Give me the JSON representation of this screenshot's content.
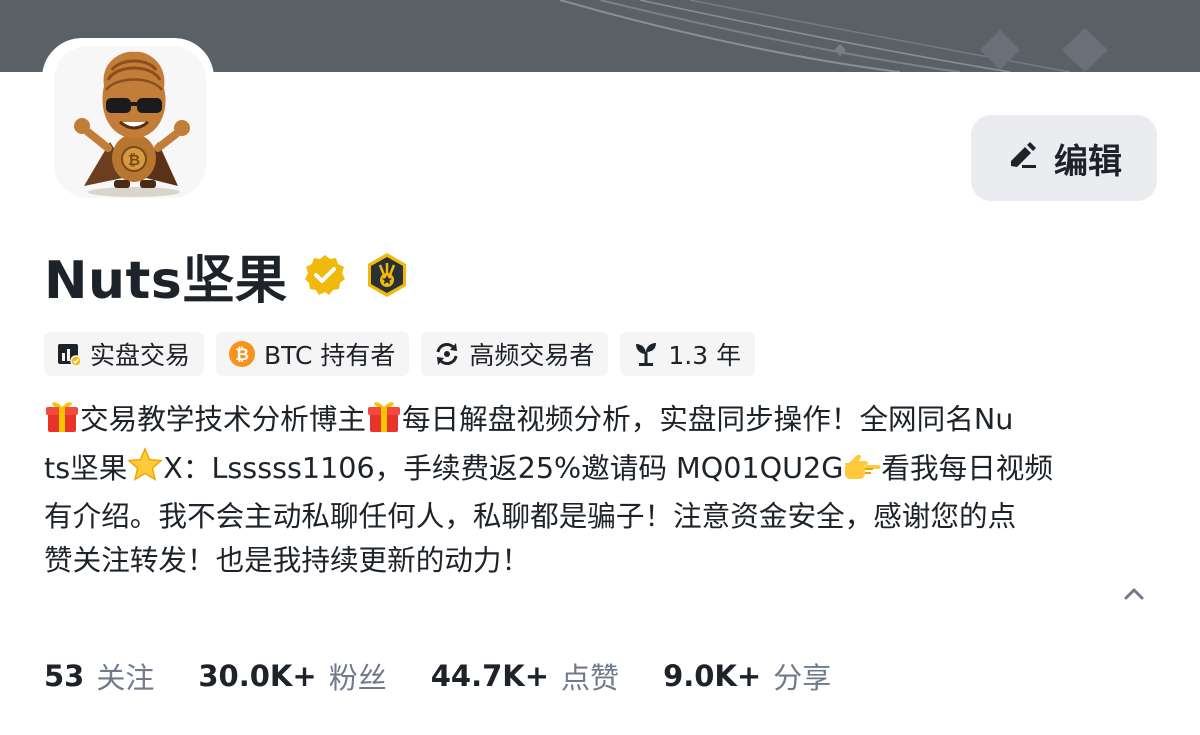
{
  "profile": {
    "name": "Nuts坚果",
    "edit_label": "编辑"
  },
  "tags": [
    {
      "label": "实盘交易",
      "icon": "real-trading-icon"
    },
    {
      "label": "BTC 持有者",
      "icon": "bitcoin-icon"
    },
    {
      "label": "高频交易者",
      "icon": "high-frequency-icon"
    },
    {
      "label": "1.3 年",
      "icon": "sprout-icon"
    }
  ],
  "bio": {
    "line1_a": "交易教学技术分析博主",
    "line1_b": "每日解盘视频分析，实盘同步操作！全网同名Nu",
    "line2_a": "ts坚果",
    "line2_b": "X：Lsssss1106，手续费返25%邀请码 MQ01QU2G",
    "line2_c": "看我每日视频",
    "line3": "有介绍。我不会主动私聊任何人，私聊都是骗子！注意资金安全，感谢您的点",
    "line4": "赞关注转发！也是我持续更新的动力！"
  },
  "stats": [
    {
      "value": "53",
      "label": "关注"
    },
    {
      "value": "30.0K+",
      "label": "粉丝"
    },
    {
      "value": "44.7K+",
      "label": "点赞"
    },
    {
      "value": "9.0K+",
      "label": "分享"
    }
  ],
  "colors": {
    "banner": "#5b5f66",
    "verified_gold": "#f0b90b",
    "text_primary": "#1e2329",
    "text_secondary": "#707a8a",
    "tag_bg": "#f5f5f5",
    "button_bg": "#eaecef"
  },
  "icons": {
    "edit": "edit-pen-icon",
    "verified": "verified-badge-icon",
    "achievement": "medal-badge-icon",
    "collapse": "chevron-up-icon"
  }
}
